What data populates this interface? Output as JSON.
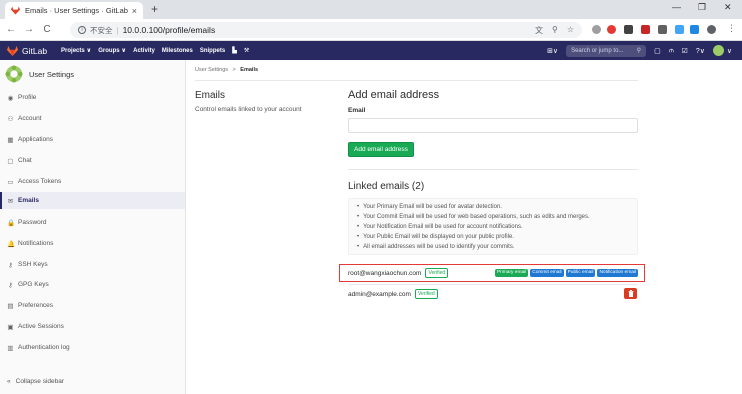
{
  "browser": {
    "tab_title": "Emails · User Settings · GitLab",
    "tab_close": "×",
    "new_tab": "+",
    "win_min": "—",
    "win_max": "❐",
    "win_close": "✕",
    "back": "←",
    "forward": "→",
    "reload": "C",
    "insecure_label": "不安全",
    "url": "10.0.0.100/profile/emails"
  },
  "header": {
    "brand": "GitLab",
    "nav": [
      "Projects ∨",
      "Groups ∨",
      "Activity",
      "Milestones",
      "Snippets"
    ],
    "search_placeholder": "Search or jump to...",
    "colors": {
      "bar": "#292961"
    }
  },
  "sidebar": {
    "title": "User Settings",
    "items": [
      {
        "label": "Profile",
        "icon": "◉"
      },
      {
        "label": "Account",
        "icon": "⚇"
      },
      {
        "label": "Applications",
        "icon": "▦"
      },
      {
        "label": "Chat",
        "icon": "▢"
      },
      {
        "label": "Access Tokens",
        "icon": "▭"
      },
      {
        "label": "Emails",
        "icon": "✉"
      },
      {
        "label": "Password",
        "icon": "🔒"
      },
      {
        "label": "Notifications",
        "icon": "🔔"
      },
      {
        "label": "SSH Keys",
        "icon": "⚷"
      },
      {
        "label": "GPG Keys",
        "icon": "⚷"
      },
      {
        "label": "Preferences",
        "icon": "▤"
      },
      {
        "label": "Active Sessions",
        "icon": "▣"
      },
      {
        "label": "Authentication log",
        "icon": "▥"
      }
    ],
    "active": "Emails",
    "collapse_label": "Collapse sidebar",
    "collapse_icon": "«"
  },
  "breadcrumb": {
    "parent": "User Settings",
    "separator": ">",
    "current": "Emails"
  },
  "left": {
    "title": "Emails",
    "description": "Control emails linked to your account"
  },
  "add": {
    "heading": "Add email address",
    "label": "Email",
    "value": "",
    "button": "Add email address"
  },
  "linked": {
    "heading": "Linked emails (2)",
    "info": [
      "Your Primary Email will be used for avatar detection.",
      "Your Commit Email will be used for web based operations, such as edits and merges.",
      "Your Notification Email will be used for account notifications.",
      "Your Public Email will be displayed on your public profile.",
      "All email addresses will be used to identify your commits."
    ],
    "emails": [
      {
        "address": "root@wangxiaochun.com",
        "status": "Verified",
        "badges": [
          "Primary email",
          "Commit email",
          "Public email",
          "Notification email"
        ]
      },
      {
        "address": "admin@example.com",
        "status": "Verified",
        "delete_icon": "trash-icon"
      }
    ]
  }
}
